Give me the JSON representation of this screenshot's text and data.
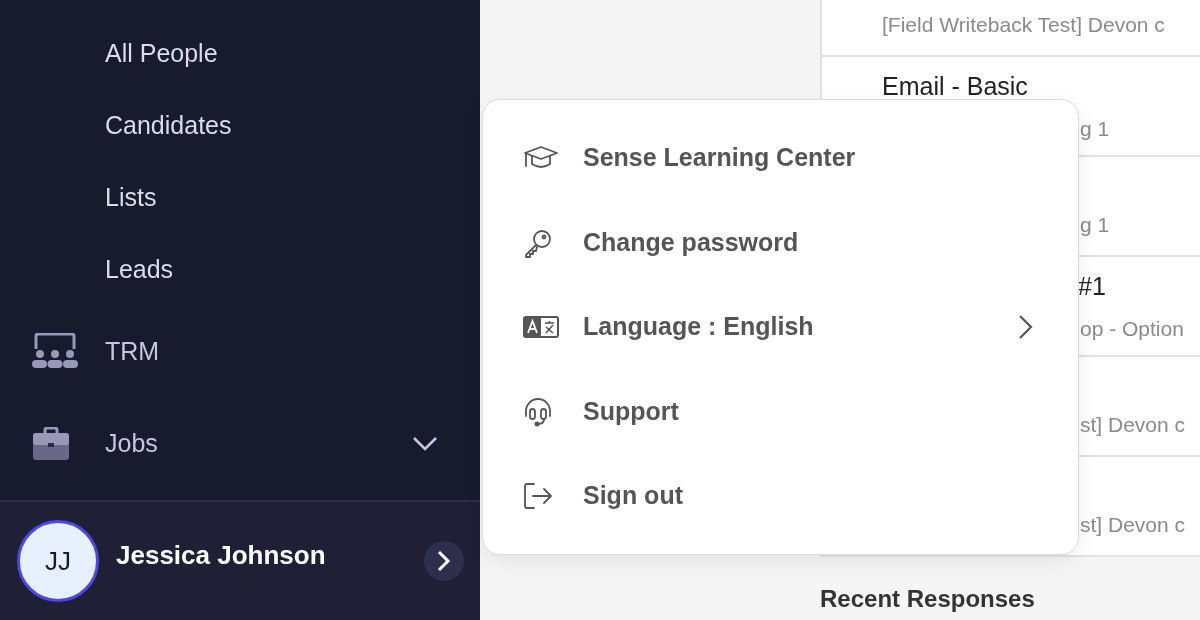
{
  "sidebar": {
    "items": [
      {
        "label": "All People",
        "kind": "sub"
      },
      {
        "label": "Candidates",
        "kind": "sub"
      },
      {
        "label": "Lists",
        "kind": "sub"
      },
      {
        "label": "Leads",
        "kind": "sub"
      },
      {
        "label": "TRM",
        "kind": "trm"
      },
      {
        "label": "Jobs",
        "kind": "jobs",
        "expanded": false
      }
    ],
    "user": {
      "initials": "JJ",
      "name": "Jessica Johnson"
    }
  },
  "content": {
    "rows": [
      {
        "kind": "top",
        "title": "",
        "subtitle": "[Field Writeback Test] Devon c"
      },
      {
        "kind": "clipped",
        "title": "Email - Basic",
        "subtitle": "g 1"
      },
      {
        "kind": "clipped",
        "title": "",
        "subtitle": "g 1"
      },
      {
        "kind": "clipped",
        "title": "#1",
        "subtitle": "op - Option"
      },
      {
        "kind": "clipped",
        "title": "",
        "subtitle": "st] Devon c"
      },
      {
        "kind": "clipped",
        "title": "",
        "subtitle": "st] Devon c"
      }
    ],
    "heading": "Recent Responses"
  },
  "menu": {
    "items": [
      {
        "label": "Sense Learning Center",
        "kind": "learning",
        "submenu": false
      },
      {
        "label": "Change password",
        "kind": "password",
        "submenu": false
      },
      {
        "label": "Language : English",
        "kind": "language",
        "submenu": true
      },
      {
        "label": "Support",
        "kind": "support",
        "submenu": false
      },
      {
        "label": "Sign out",
        "kind": "signout",
        "submenu": false
      }
    ]
  }
}
